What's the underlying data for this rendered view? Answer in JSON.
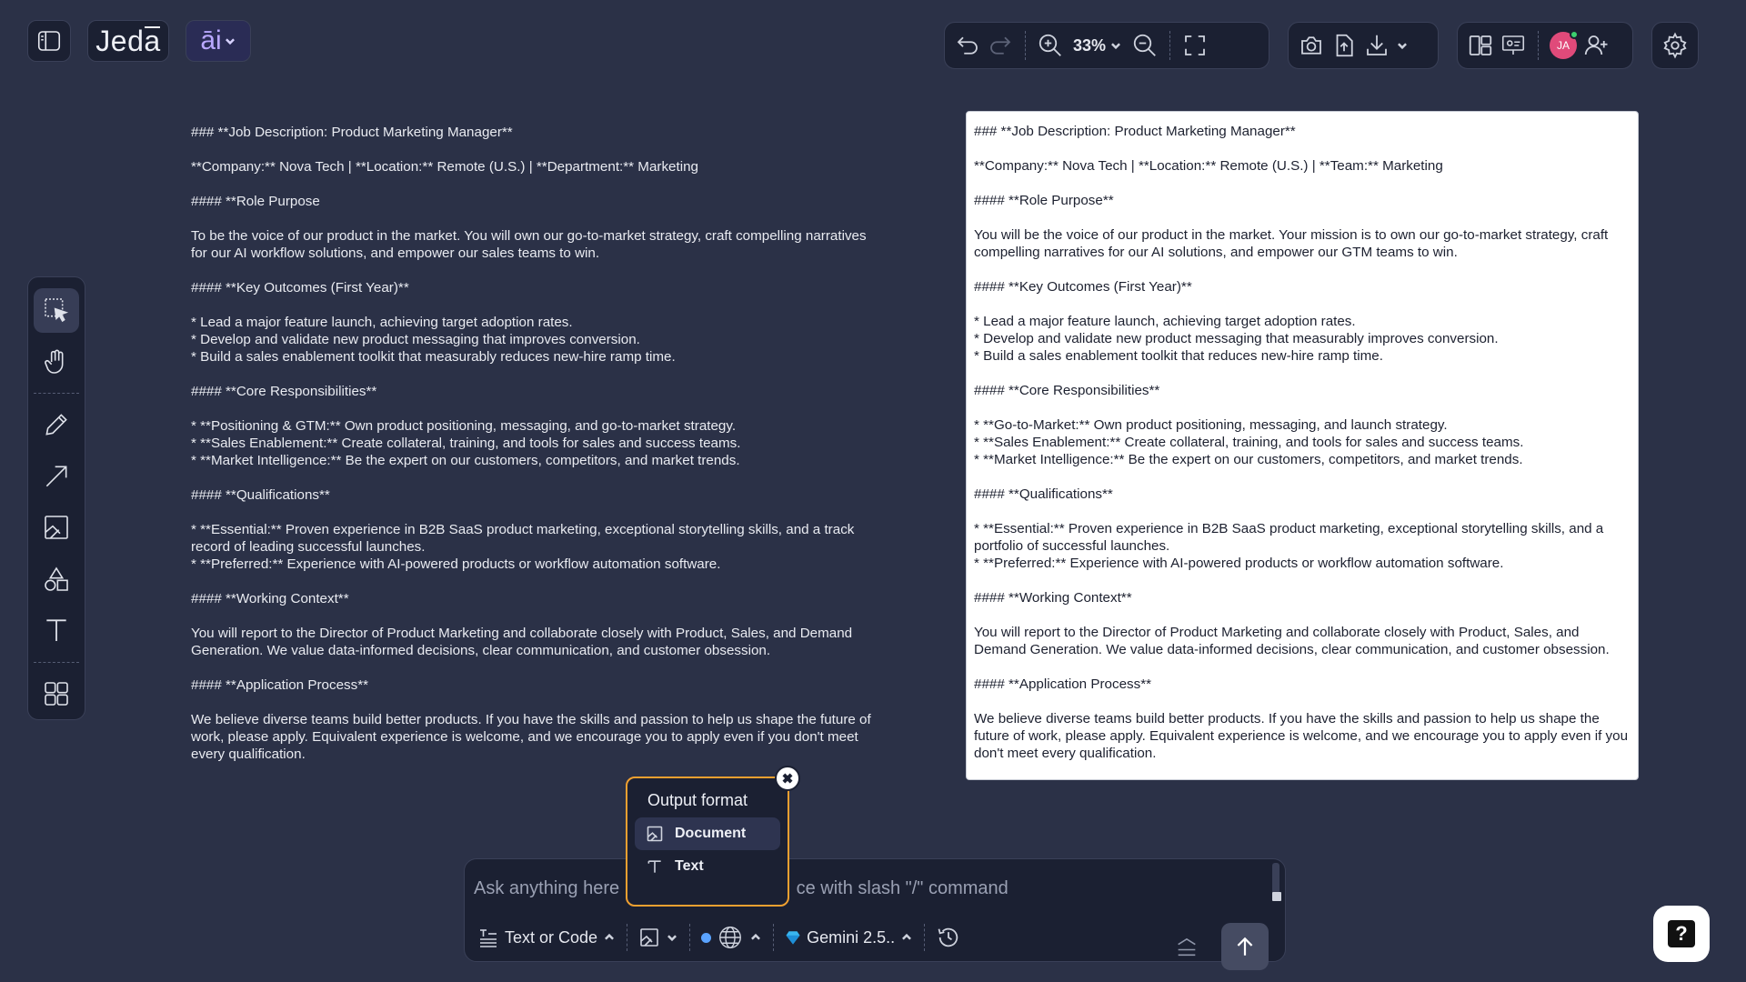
{
  "brand": {
    "logo_text_1": "Jed",
    "logo_text_2": "a",
    "ai_label": "āi"
  },
  "toolbar": {
    "zoom": "33%"
  },
  "avatar": {
    "initials": "JA"
  },
  "left_doc": {
    "lines": [
      "### **Job Description: Product Marketing Manager**",
      "**Company:** Nova Tech | **Location:** Remote (U.S.) | **Department:** Marketing",
      "#### **Role Purpose",
      "To be the voice of our product in the market. You will own our go-to-market strategy, craft compelling narratives for our AI workflow solutions, and empower our sales teams to win.",
      "#### **Key Outcomes (First Year)**",
      "*   Lead a major feature launch, achieving target adoption rates.",
      "*   Develop and validate new product messaging that improves conversion.",
      "*   Build a sales enablement toolkit that measurably reduces new-hire ramp time.",
      "#### **Core Responsibilities**",
      "*   **Positioning & GTM:** Own product positioning, messaging, and go-to-market strategy.",
      "*   **Sales Enablement:** Create collateral, training, and tools for sales and success teams.",
      "*   **Market Intelligence:** Be the expert on our customers, competitors, and market trends.",
      "#### **Qualifications**",
      "*   **Essential:** Proven experience in B2B SaaS product marketing, exceptional storytelling skills, and a track record of leading successful launches.",
      "*   **Preferred:** Experience with AI-powered products or workflow automation software.",
      "#### **Working Context**",
      "You will report to the Director of Product Marketing and collaborate closely with Product, Sales, and Demand Generation. We value data-informed decisions, clear communication, and customer obsession.",
      "#### **Application Process**",
      "We believe diverse teams build better products. If you have the skills and passion to help us shape the future of work, please apply. Equivalent experience is welcome, and we encourage you to apply even if you don't meet every qualification."
    ]
  },
  "right_doc": {
    "lines": [
      "### **Job Description: Product Marketing Manager**",
      "**Company:** Nova Tech | **Location:** Remote (U.S.) | **Team:** Marketing",
      "#### **Role Purpose**",
      "You will be the voice of our product in the market. Your mission is to own our go-to-market strategy, craft compelling narratives for our AI solutions, and empower our GTM teams to win.",
      "#### **Key Outcomes (First Year)**",
      "*   Lead a major feature launch, achieving target adoption rates.",
      "*   Develop and validate new product messaging that measurably improves conversion.",
      "*   Build a sales enablement toolkit that reduces new-hire ramp time.",
      "#### **Core Responsibilities**",
      "*   **Go-to-Market:** Own product positioning, messaging, and launch strategy.",
      "*   **Sales Enablement:** Create collateral, training, and tools for sales and success teams.",
      "*   **Market Intelligence:** Be the expert on our customers, competitors, and market trends.",
      "#### **Qualifications**",
      "*   **Essential:** Proven experience in B2B SaaS product marketing, exceptional storytelling skills, and a portfolio of successful launches.",
      "*   **Preferred:** Experience with AI-powered products or workflow automation software.",
      "#### **Working Context**",
      "You will report to the Director of Product Marketing and collaborate closely with Product, Sales, and Demand Generation. We value data-informed decisions, clear communication, and customer obsession.",
      "#### **Application Process**",
      "We believe diverse teams build better products. If you have the skills and passion to help us shape the future of work, please apply. Equivalent experience is welcome, and we encourage you to apply even if you don't meet every qualification."
    ]
  },
  "format_popup": {
    "title": "Output format",
    "options": [
      {
        "label": "Document"
      },
      {
        "label": "Text"
      }
    ]
  },
  "prompt": {
    "placeholder": "Ask anything here                                   ce with slash \"/\" command",
    "mode_label": "Text or Code",
    "model_label": "Gemini 2.5.."
  },
  "help": {
    "label": "?"
  }
}
